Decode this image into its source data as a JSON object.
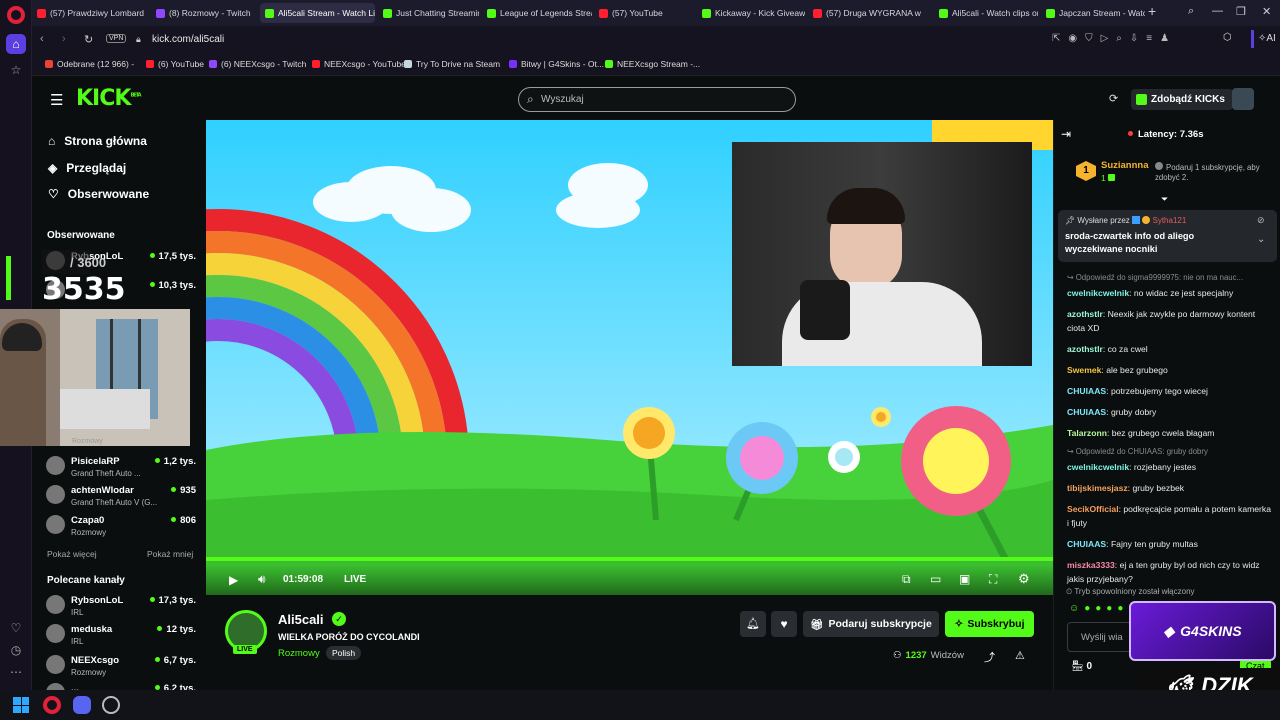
{
  "browser": {
    "tabs": [
      {
        "label": "(57) Prawdziwy Lombard",
        "icon": "youtube-icon"
      },
      {
        "label": "(8) Rozmowy - Twitch",
        "icon": "twitch-icon"
      },
      {
        "label": "Ali5cali Stream - Watch Li",
        "icon": "kick-icon",
        "active": true
      },
      {
        "label": "Just Chatting Streaming",
        "icon": "kick-icon"
      },
      {
        "label": "League of Legends Strea",
        "icon": "kick-icon"
      },
      {
        "label": "(57) YouTube",
        "icon": "youtube-icon"
      },
      {
        "label": "Kickaway - Kick Giveawa",
        "icon": "kick-icon"
      },
      {
        "label": "(57) Druga WYGRANA w",
        "icon": "youtube-icon"
      },
      {
        "label": "Ali5cali - Watch clips on",
        "icon": "kick-icon"
      },
      {
        "label": "Japczan Stream - Watch",
        "icon": "kick-icon"
      }
    ],
    "new_tab": "+",
    "url": "kick.com/ali5cali",
    "vpn_label": "VPN",
    "ai_label": "AI",
    "bookmarks": [
      {
        "label": "Odebrane (12 966) -",
        "icon": "gmail-icon"
      },
      {
        "label": "(6) YouTube",
        "icon": "youtube-icon"
      },
      {
        "label": "(6) NEEXcsgo - Twitch",
        "icon": "twitch-icon"
      },
      {
        "label": "NEEXcsgo - YouTube",
        "icon": "youtube-icon"
      },
      {
        "label": "Try To Drive na Steam",
        "icon": "steam-icon"
      },
      {
        "label": "Bitwy | G4Skins - Ot...",
        "icon": "g4skins-icon"
      },
      {
        "label": "NEEXcsgo Stream -...",
        "icon": "kick-icon"
      }
    ]
  },
  "kick": {
    "logo": "KICK",
    "logo_beta": "BETA",
    "search_placeholder": "Wyszukaj",
    "kicks_button": "Zdobądź KICKs",
    "nav": [
      {
        "label": "Strona główna",
        "icon": "home-icon"
      },
      {
        "label": "Przeglądaj",
        "icon": "compass-icon"
      },
      {
        "label": "Obserwowane",
        "icon": "heart-icon"
      }
    ],
    "followed_title": "Obserwowane",
    "followed": [
      {
        "name": "RybsonLoL",
        "category": "",
        "viewers": "17,5 tys."
      },
      {
        "name": "",
        "category": "",
        "viewers": "10,3 tys."
      },
      {
        "name": "PisicelaRP",
        "category": "Grand Theft Auto ...",
        "viewers": "1,2 tys."
      },
      {
        "name": "achtenWlodar",
        "category": "Grand Theft Auto V (G...",
        "viewers": "935"
      },
      {
        "name": "Czapa0",
        "category": "Rozmowy",
        "viewers": "806"
      }
    ],
    "overlay_category": "Rozmowy",
    "show_more": "Pokaż więcej",
    "show_less": "Pokaż mniej",
    "recommended_title": "Polecane kanały",
    "recommended": [
      {
        "name": "RybsonLoL",
        "category": "IRL",
        "viewers": "17,3 tys."
      },
      {
        "name": "meduska",
        "category": "IRL",
        "viewers": "12 tys."
      },
      {
        "name": "NEEXcsgo",
        "category": "Rozmowy",
        "viewers": "6,7 tys."
      },
      {
        "name": "...",
        "category": "",
        "viewers": "6,2 tys."
      }
    ],
    "counter": {
      "top": "/ 3600",
      "main": "3535"
    }
  },
  "player": {
    "time": "01:59:08",
    "live_label": "LIVE",
    "progress": 1.0
  },
  "stream_info": {
    "channel": "Ali5cali",
    "title": "WIELKA PORÓŻ DO CYCOLANDI",
    "category": "Rozmowy",
    "language": "Polish",
    "live_badge": "LIVE",
    "gift_button": "Podaruj subskrypcje",
    "subscribe_button": "Subskrybuj",
    "viewers": "1237",
    "viewers_label": "Widzów"
  },
  "chat": {
    "latency": "Latency: 7.36s",
    "leader": {
      "rank": "1",
      "name": "Suziannna",
      "count": "1"
    },
    "gift_hint": "Podaruj 1 subskrypcję, aby zdobyć 2.",
    "pinned": {
      "label": "Wysłane przez",
      "sender": "Sytha121",
      "text": "sroda-czwartek info od aliego wyczekiwane nocniki"
    },
    "messages": [
      {
        "type": "reply",
        "text": "Odpowiedź do sigma9999975: nie on ma nauc..."
      },
      {
        "user": "cwelnikcwelnik",
        "color": "#7ef0e0",
        "text": "no widac ze jest specjalny"
      },
      {
        "user": "azothstlr",
        "color": "#9ef7d4",
        "text": "Neexik jak zwykle po darmowy kontent ciota XD"
      },
      {
        "user": "azothstlr",
        "color": "#9ef7d4",
        "text": "co za cwel"
      },
      {
        "user": "Swemek",
        "color": "#f5c542",
        "text": "ale bez grubego"
      },
      {
        "user": "CHUIAAS",
        "color": "#7ee8f5",
        "text": "potrzebujemy tego wiecej"
      },
      {
        "user": "CHUIAAS",
        "color": "#7ee8f5",
        "text": "gruby dobry"
      },
      {
        "user": "Talarzonn",
        "color": "#b7f5a0",
        "text": "bez grubego cwela błagam"
      },
      {
        "type": "reply",
        "text": "Odpowiedź do CHUIAAS: gruby dobry"
      },
      {
        "user": "cwelnikcwelnik",
        "color": "#7ef0e0",
        "text": "rozjebany jestes"
      },
      {
        "user": "tibijskimesjasz",
        "color": "#f5a35e",
        "text": "gruby bezbek"
      },
      {
        "user": "SecikOfficial",
        "color": "#f59f5e",
        "text": "podkręcajcie pomału a potem kamerka i fjuty"
      },
      {
        "user": "CHUIAAS",
        "color": "#7ee8f5",
        "text": "Fajny ten gruby multas"
      },
      {
        "user": "miszka3333",
        "color": "#f58aa6",
        "text": "ej a ten gruby byl od nich czy to widz jakis przyjebany?"
      }
    ],
    "slow_mode": "Tryb spowolniony został włączony",
    "input_placeholder": "Wyślij wia",
    "kicks_count": "0",
    "send_label": "Czat",
    "sponsor_1": "G4SKINS",
    "sponsor_2": "DZIK"
  },
  "colors": {
    "kick_green": "#53fc18",
    "sky": "#38c7f0",
    "grass": "#3ecb32"
  }
}
